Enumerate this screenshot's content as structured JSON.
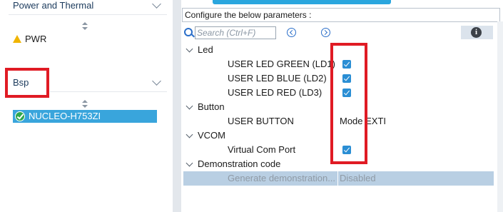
{
  "left_panel": {
    "power_section": {
      "title": "Power and Thermal",
      "items": [
        {
          "label": "PWR",
          "status_icon": "warning-icon"
        }
      ]
    },
    "bsp_section": {
      "title": "Bsp",
      "items": [
        {
          "label": "NUCLEO-H753ZI",
          "status_icon": "check-circle-icon",
          "selected": true
        }
      ]
    }
  },
  "right_panel": {
    "top_tab_label": "",
    "config_header": "Configure the below parameters :",
    "search": {
      "placeholder": "Search (Ctrl+F)",
      "value": ""
    },
    "groups": [
      {
        "label": "Led",
        "params": [
          {
            "label": "USER LED GREEN (LD1)",
            "type": "checkbox",
            "checked": true
          },
          {
            "label": "USER LED BLUE (LD2)",
            "type": "checkbox",
            "checked": true
          },
          {
            "label": "USER LED RED (LD3)",
            "type": "checkbox",
            "checked": true
          }
        ]
      },
      {
        "label": "Button",
        "params": [
          {
            "label": "USER BUTTON",
            "type": "text",
            "value": "Mode EXTI"
          }
        ]
      },
      {
        "label": "VCOM",
        "params": [
          {
            "label": "Virtual Com Port",
            "type": "checkbox",
            "checked": true
          }
        ]
      },
      {
        "label": "Demonstration code",
        "params": [
          {
            "label": "Generate demonstration...",
            "type": "text",
            "value": "Disabled",
            "disabled": true
          }
        ]
      }
    ]
  },
  "colors": {
    "accent": "#39a5dc",
    "highlight_box": "#e01b24",
    "checkbox": "#2a8ed4",
    "warning": "#f0b400",
    "success": "#2fa84f"
  }
}
